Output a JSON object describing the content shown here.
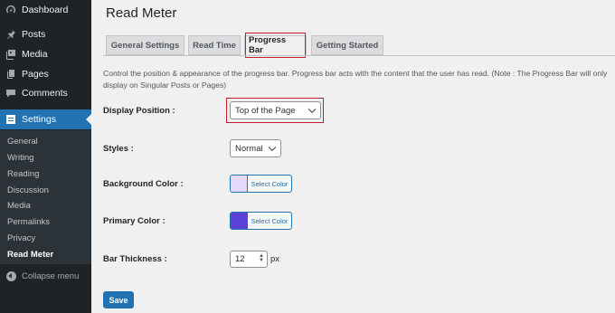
{
  "sidebar": {
    "items": [
      {
        "label": "Dashboard",
        "icon": "dashboard-icon"
      },
      {
        "label": "Posts",
        "icon": "pin-icon"
      },
      {
        "label": "Media",
        "icon": "media-icon"
      },
      {
        "label": "Pages",
        "icon": "pages-icon"
      },
      {
        "label": "Comments",
        "icon": "comment-icon"
      },
      {
        "label": "Settings",
        "icon": "settings-icon",
        "active": true
      }
    ],
    "submenu": [
      "General",
      "Writing",
      "Reading",
      "Discussion",
      "Media",
      "Permalinks",
      "Privacy",
      "Read Meter"
    ],
    "submenu_current": "Read Meter",
    "collapse_label": "Collapse menu"
  },
  "page": {
    "title": "Read Meter",
    "tabs": [
      "General Settings",
      "Read Time",
      "Progress Bar",
      "Getting Started"
    ],
    "active_tab": "Progress Bar",
    "description": "Control the position & appearance of the progress bar. Progress bar acts with the content that the user has read. (Note : The Progress Bar will only display on Singular Posts or Pages)"
  },
  "form": {
    "display_position": {
      "label": "Display Position :",
      "value": "Top of the Page"
    },
    "styles": {
      "label": "Styles :",
      "value": "Normal"
    },
    "background_color": {
      "label": "Background Color :",
      "button": "Select Color",
      "color": "#e5d9fb"
    },
    "primary_color": {
      "label": "Primary Color :",
      "button": "Select Color",
      "color": "#5b3fd9"
    },
    "bar_thickness": {
      "label": "Bar Thickness :",
      "value": "12",
      "unit": "px"
    },
    "save_label": "Save"
  },
  "colors": {
    "accent": "#2271b1",
    "sidebar": "#1d2327",
    "highlight_border": "#c0202a"
  }
}
